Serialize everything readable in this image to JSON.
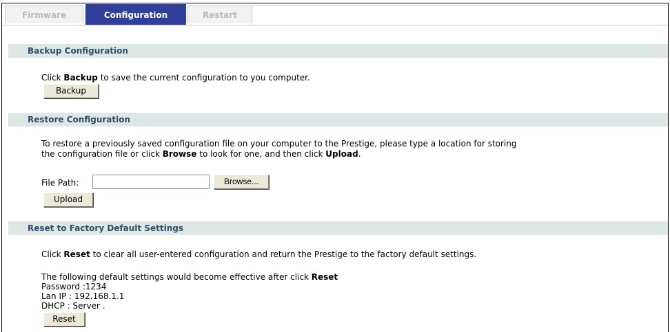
{
  "tabs": [
    {
      "label": "Firmware",
      "active": false
    },
    {
      "label": "Configuration",
      "active": true
    },
    {
      "label": "Restart",
      "active": false
    }
  ],
  "backup": {
    "heading": "Backup Configuration",
    "desc_pre": "Click ",
    "desc_bold": "Backup",
    "desc_post": " to save the current configuration to you computer.",
    "button": "Backup"
  },
  "restore": {
    "heading": "Restore Configuration",
    "line1": "To restore a previously saved configuration file on your computer to the Prestige, please type a location for storing",
    "line2_pre": "the configuration file or click ",
    "line2_bold1": "Browse",
    "line2_mid": " to look for one, and then click ",
    "line2_bold2": "Upload",
    "line2_post": ".",
    "file_path_label": "File Path:",
    "file_path_value": "",
    "browse_button": "Browse...",
    "upload_button": "Upload"
  },
  "reset": {
    "heading": "Reset to Factory Default Settings",
    "desc_pre": "Click ",
    "desc_bold": "Reset",
    "desc_post": " to clear all user-entered configuration and return the Prestige to the factory default settings.",
    "defaults_pre": "The following default settings would become effective after click ",
    "defaults_bold": "Reset",
    "password": "Password :1234",
    "lan_ip": "Lan IP : 192.168.1.1",
    "dhcp": "DHCP : Server .",
    "button": "Reset"
  }
}
